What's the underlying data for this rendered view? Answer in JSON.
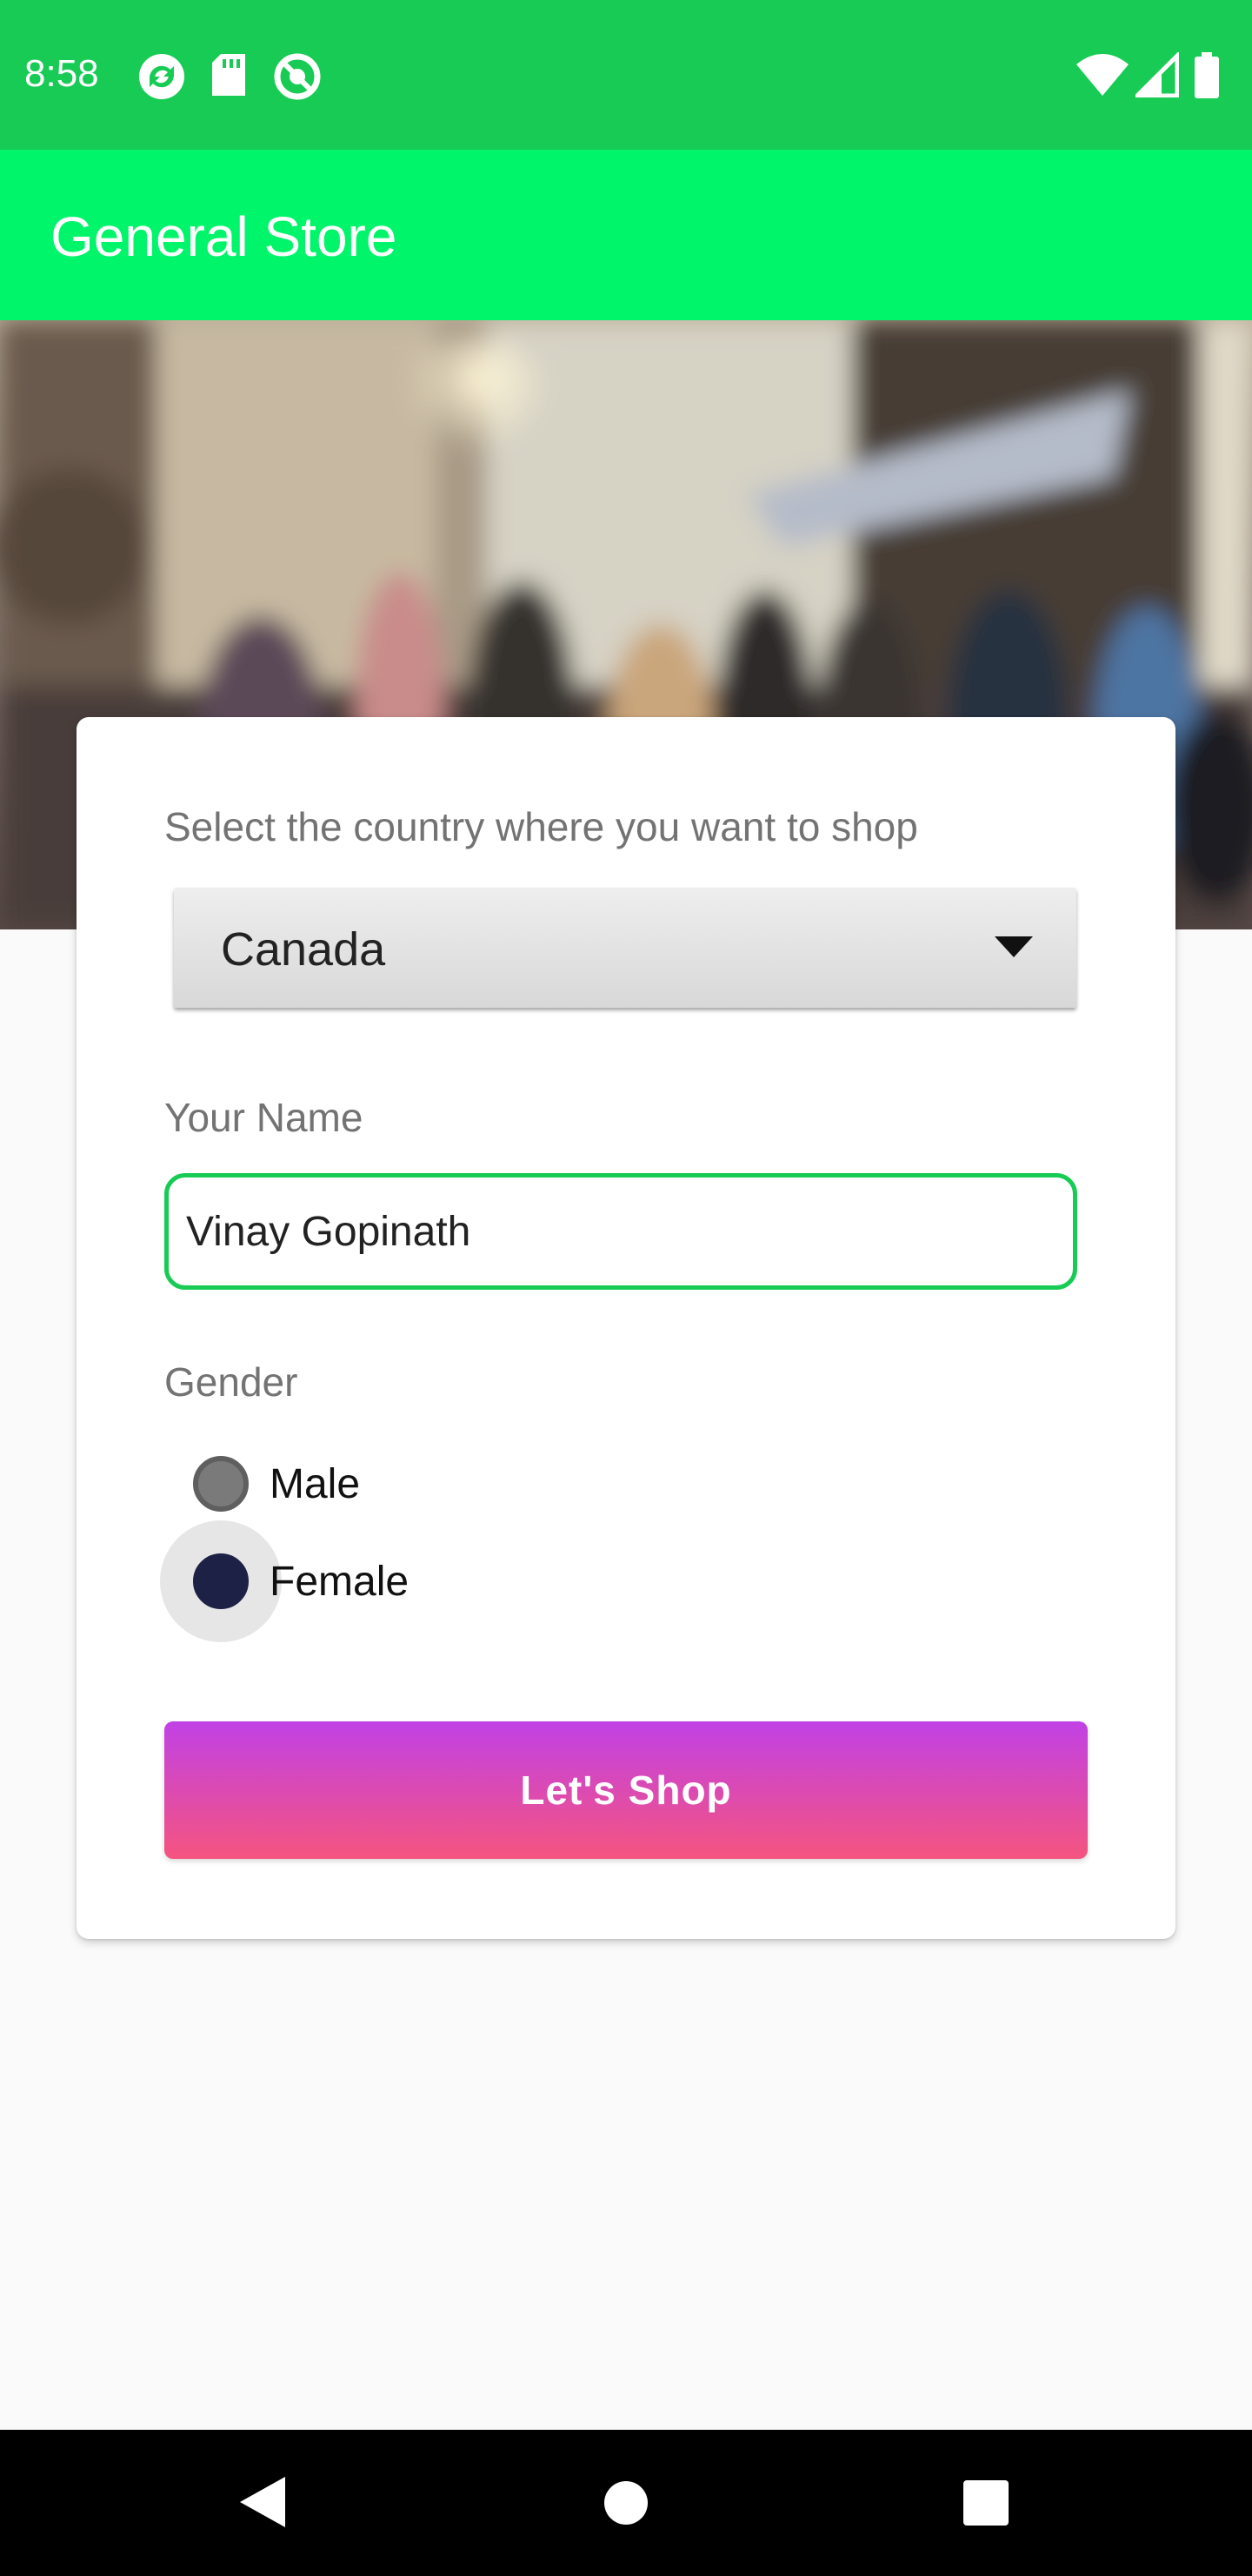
{
  "status_bar": {
    "time": "8:58",
    "left_icons": [
      "sync-icon",
      "sd-card-icon",
      "no-sim-icon"
    ],
    "right_icons": [
      "wifi-icon",
      "signal-icon",
      "battery-icon"
    ],
    "color": "#17cb54"
  },
  "app_bar": {
    "title": "General Store",
    "color": "#00f56a"
  },
  "form": {
    "country_label": "Select the country where you want to shop",
    "country_selected": "Canada",
    "name_label": "Your Name",
    "name_value": "Vinay Gopinath",
    "gender_label": "Gender",
    "gender_options": [
      {
        "label": "Male",
        "checked": false
      },
      {
        "label": "Female",
        "checked": true
      }
    ],
    "shop_button_label": "Let's  Shop"
  },
  "nav_bar": {
    "buttons": [
      "back-icon",
      "home-icon",
      "recents-icon"
    ]
  }
}
